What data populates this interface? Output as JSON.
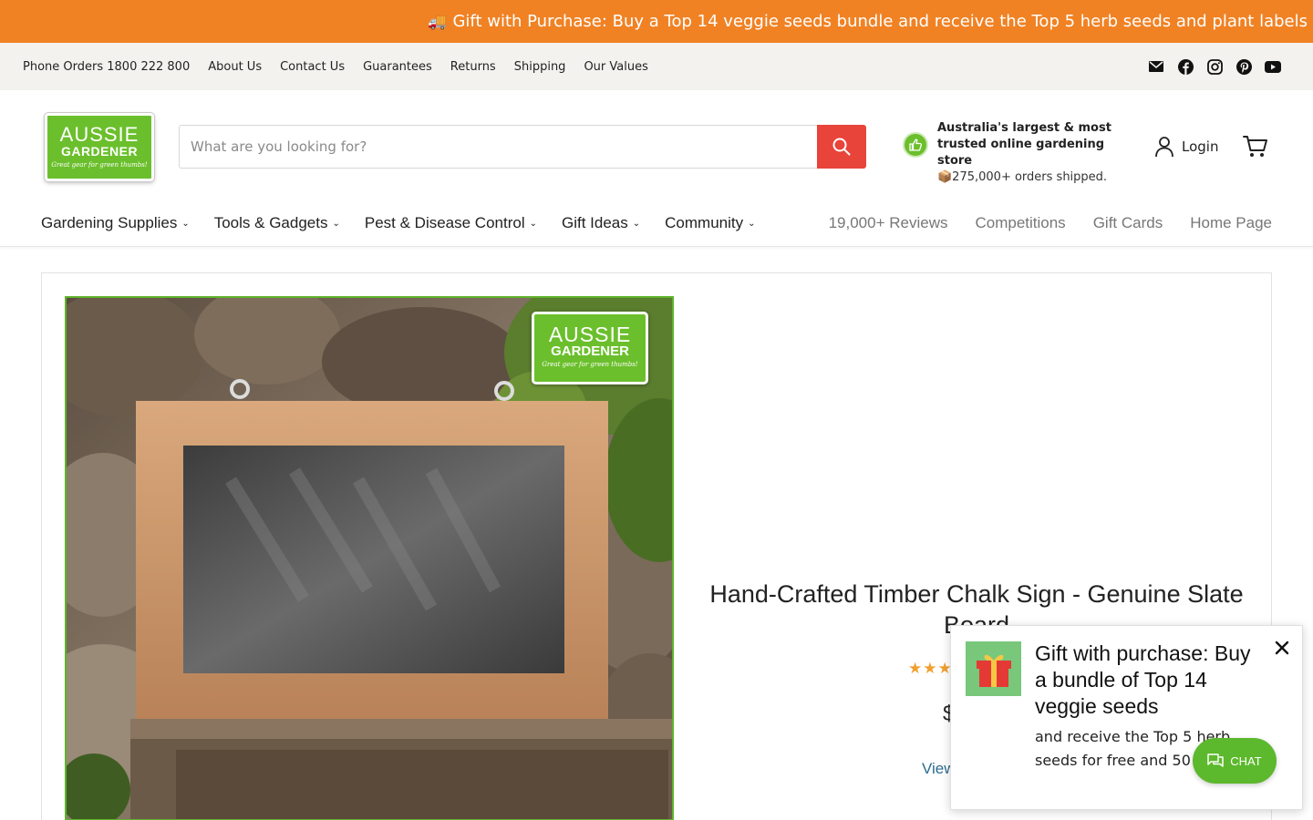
{
  "promo": {
    "icon": "truck-emoji",
    "text": "Gift with Purchase: Buy a Top 14 veggie seeds bundle and receive the Top 5 herb seeds and plant labels"
  },
  "util": {
    "links": [
      "Phone Orders 1800 222 800",
      "About Us",
      "Contact Us",
      "Guarantees",
      "Returns",
      "Shipping",
      "Our Values"
    ],
    "social_icons": [
      "mail-icon",
      "facebook-icon",
      "instagram-icon",
      "pinterest-icon",
      "youtube-icon"
    ]
  },
  "header": {
    "logo": {
      "line1": "AUSSIE",
      "line2": "GARDENER",
      "tagline": "Great gear for green thumbs!"
    },
    "search_placeholder": "What are you looking for?",
    "search_value": "",
    "trust_title": "Australia's largest & most trusted online gardening store",
    "trust_sub": "📦275,000+ orders shipped.",
    "login_label": "Login",
    "brand_green": "#6bbf2c",
    "search_button_color": "#e8443a"
  },
  "nav": {
    "menu": [
      "Gardening Supplies",
      "Tools & Gadgets",
      "Pest & Disease Control",
      "Gift Ideas",
      "Community"
    ],
    "links": [
      "19,000+ Reviews",
      "Competitions",
      "Gift Cards",
      "Home Page"
    ]
  },
  "product": {
    "title": "Hand-Crafted Timber Chalk Sign - Genuine Slate Board",
    "stars": "★★★★★",
    "price_partial": "$",
    "view_link_partial": "View"
  },
  "popup": {
    "heading": "Gift with purchase: Buy a bundle of Top 14 veggie seeds",
    "body": "and receive the Top 5 herb seeds for free and 50 labels!"
  },
  "chat": {
    "label": "CHAT"
  }
}
